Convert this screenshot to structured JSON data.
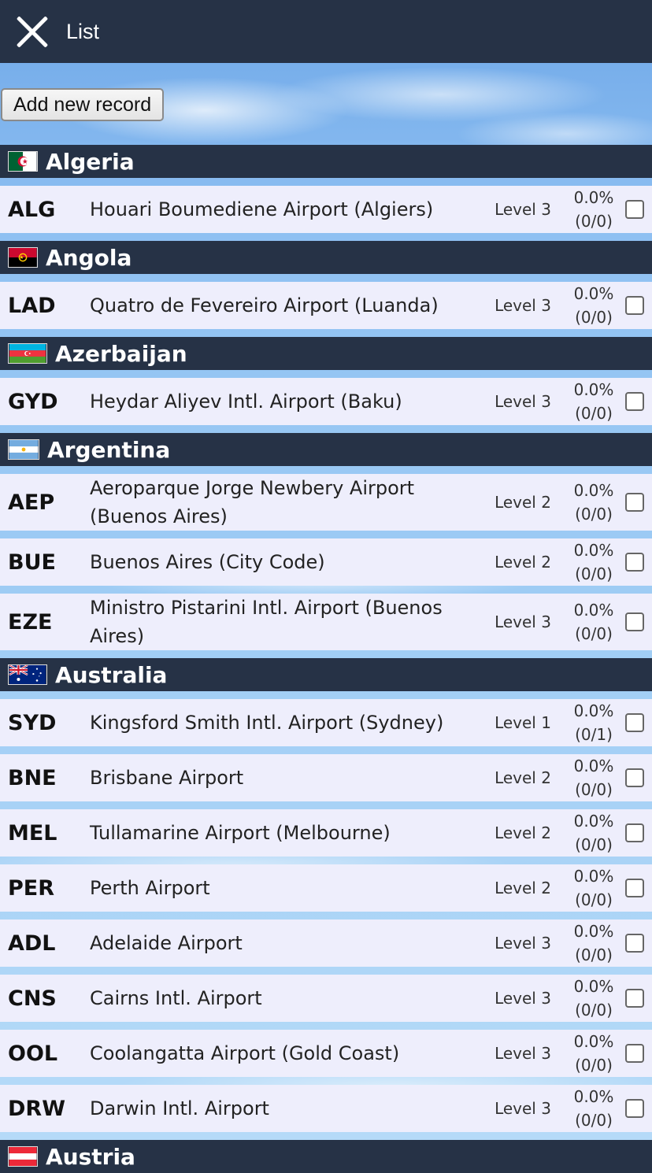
{
  "header": {
    "title": "List"
  },
  "toolbar": {
    "add_label": "Add new record"
  },
  "countries": [
    {
      "name": "Algeria",
      "flag": "algeria-flag-icon",
      "airports": [
        {
          "code": "ALG",
          "name": "Houari Boumediene Airport (Algiers)",
          "level": "Level 3",
          "percent": "0.0%",
          "count": "(0/0)"
        }
      ]
    },
    {
      "name": "Angola",
      "flag": "angola-flag-icon",
      "airports": [
        {
          "code": "LAD",
          "name": "Quatro de Fevereiro Airport (Luanda)",
          "level": "Level 3",
          "percent": "0.0%",
          "count": "(0/0)"
        }
      ]
    },
    {
      "name": "Azerbaijan",
      "flag": "azerbaijan-flag-icon",
      "airports": [
        {
          "code": "GYD",
          "name": "Heydar Aliyev Intl. Airport (Baku)",
          "level": "Level 3",
          "percent": "0.0%",
          "count": "(0/0)"
        }
      ]
    },
    {
      "name": "Argentina",
      "flag": "argentina-flag-icon",
      "airports": [
        {
          "code": "AEP",
          "name": "Aeroparque Jorge Newbery Airport (Buenos Aires)",
          "level": "Level 2",
          "percent": "0.0%",
          "count": "(0/0)"
        },
        {
          "code": "BUE",
          "name": "Buenos Aires (City Code)",
          "level": "Level 2",
          "percent": "0.0%",
          "count": "(0/0)"
        },
        {
          "code": "EZE",
          "name": "Ministro Pistarini Intl. Airport (Buenos Aires)",
          "level": "Level 3",
          "percent": "0.0%",
          "count": "(0/0)"
        }
      ]
    },
    {
      "name": "Australia",
      "flag": "australia-flag-icon",
      "airports": [
        {
          "code": "SYD",
          "name": "Kingsford Smith Intl. Airport (Sydney)",
          "level": "Level 1",
          "percent": "0.0%",
          "count": "(0/1)"
        },
        {
          "code": "BNE",
          "name": "Brisbane Airport",
          "level": "Level 2",
          "percent": "0.0%",
          "count": "(0/0)"
        },
        {
          "code": "MEL",
          "name": "Tullamarine Airport (Melbourne)",
          "level": "Level 2",
          "percent": "0.0%",
          "count": "(0/0)"
        },
        {
          "code": "PER",
          "name": "Perth Airport",
          "level": "Level 2",
          "percent": "0.0%",
          "count": "(0/0)"
        },
        {
          "code": "ADL",
          "name": "Adelaide Airport",
          "level": "Level 3",
          "percent": "0.0%",
          "count": "(0/0)"
        },
        {
          "code": "CNS",
          "name": "Cairns Intl. Airport",
          "level": "Level 3",
          "percent": "0.0%",
          "count": "(0/0)"
        },
        {
          "code": "OOL",
          "name": "Coolangatta Airport (Gold Coast)",
          "level": "Level 3",
          "percent": "0.0%",
          "count": "(0/0)"
        },
        {
          "code": "DRW",
          "name": "Darwin Intl. Airport",
          "level": "Level 3",
          "percent": "0.0%",
          "count": "(0/0)"
        }
      ]
    },
    {
      "name": "Austria",
      "flag": "austria-flag-icon",
      "airports": []
    }
  ]
}
